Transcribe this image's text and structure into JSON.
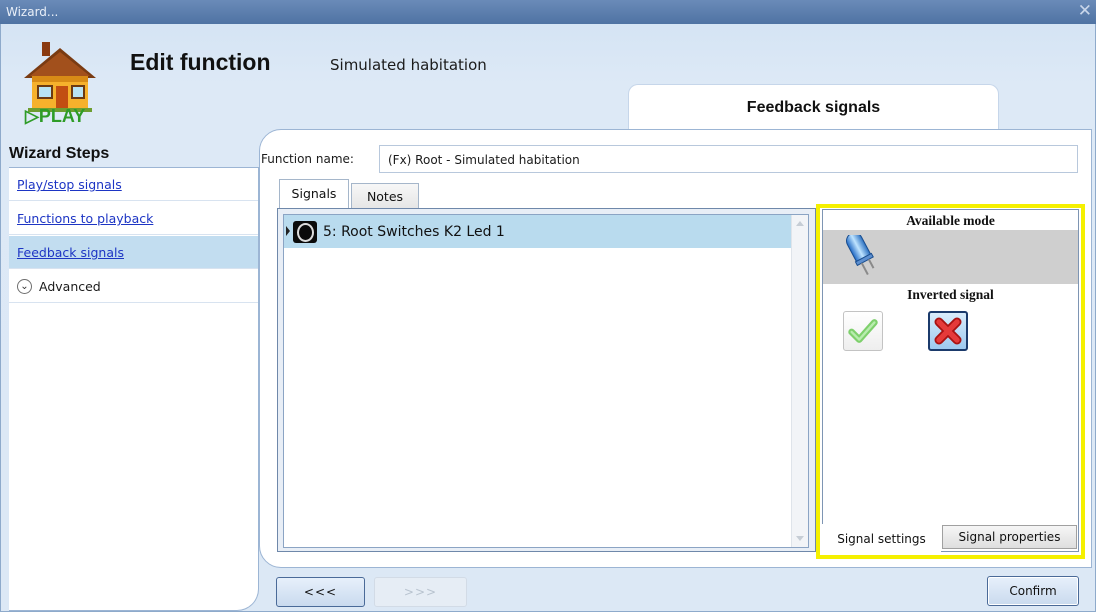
{
  "window": {
    "title": "Wizard...",
    "close_glyph": "✕"
  },
  "header": {
    "logo_label": "PLAY",
    "title": "Edit function",
    "subtitle": "Simulated habitation",
    "current_step": "Feedback signals"
  },
  "sidebar": {
    "title": "Wizard Steps",
    "items": [
      {
        "label": "Play/stop signals",
        "active": false
      },
      {
        "label": "Functions to playback",
        "active": false
      },
      {
        "label": "Feedback signals",
        "active": true
      }
    ],
    "advanced": {
      "label": "Advanced",
      "icon": "chevron-down-circle-icon"
    }
  },
  "form": {
    "function_name_label": "Function name:",
    "function_name_value": "(Fx) Root - Simulated habitation"
  },
  "tabs": [
    {
      "label": "Signals",
      "selected": true
    },
    {
      "label": "Notes",
      "selected": false
    }
  ],
  "signals": {
    "rows": [
      {
        "label": "5: Root Switches K2 Led 1",
        "icon": "led-signal-icon",
        "selected": true
      }
    ]
  },
  "settings": {
    "available_mode_title": "Available mode",
    "mode_icon": "led-bulb-icon",
    "inverted_signal_title": "Inverted signal",
    "inverted_options": [
      {
        "name": "yes",
        "icon": "check-icon",
        "selected": false
      },
      {
        "name": "no",
        "icon": "x-icon",
        "selected": true
      }
    ],
    "tabs": [
      {
        "label": "Signal settings",
        "selected": true
      },
      {
        "label": "Signal properties",
        "selected": false
      }
    ]
  },
  "buttons": {
    "back": "<<<",
    "next": ">>>",
    "confirm": "Confirm"
  },
  "colors": {
    "highlight": "#f5f000",
    "selected_row": "#b9dbee",
    "link": "#1d35c4",
    "play_green": "#2e9c27"
  }
}
